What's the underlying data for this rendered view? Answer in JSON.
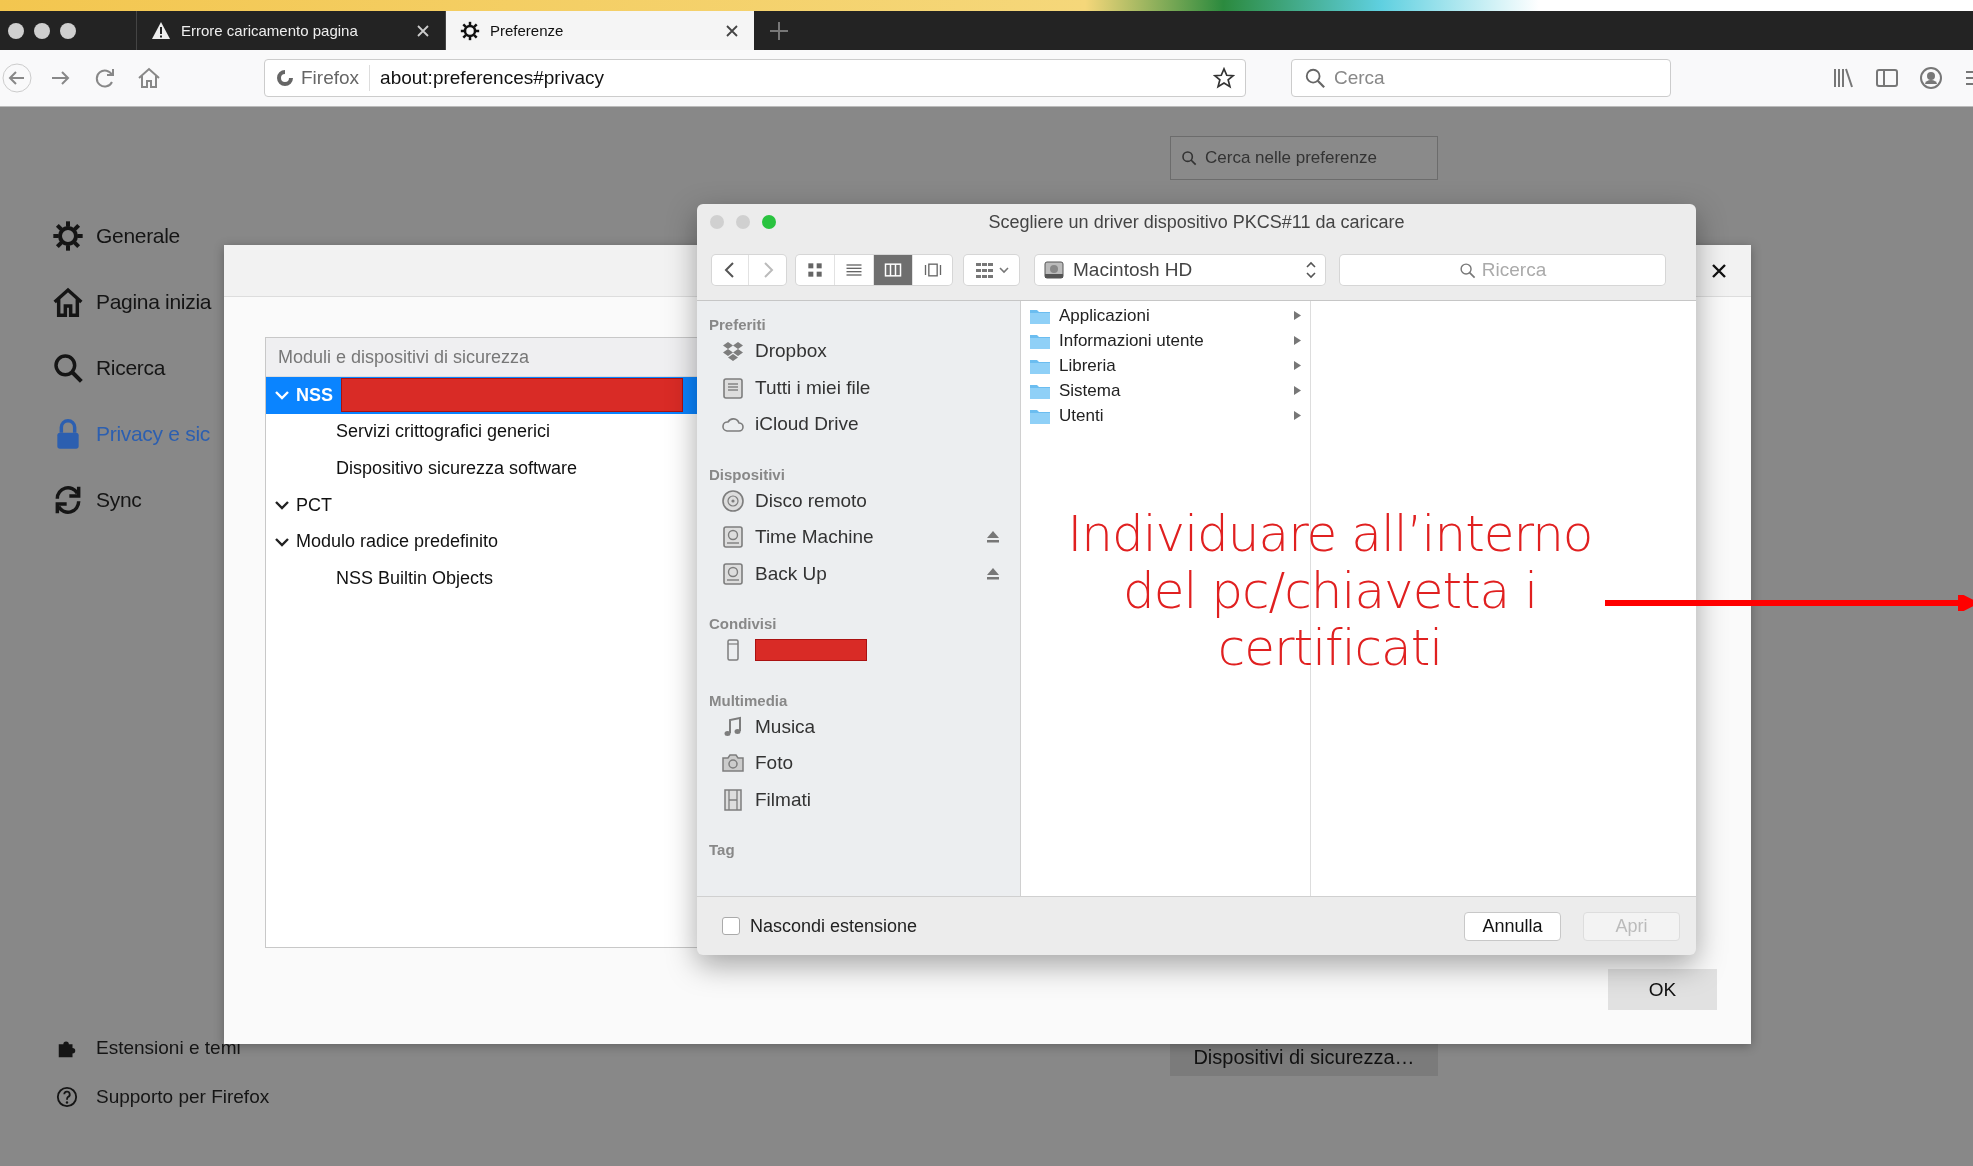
{
  "browser": {
    "tabs": [
      {
        "title": "Errore caricamento pagina",
        "kind": "warning",
        "selected": false
      },
      {
        "title": "Preferenze",
        "kind": "settings",
        "selected": true
      }
    ],
    "url_bar": {
      "identity": "Firefox",
      "value": "about:preferences#privacy"
    },
    "search": {
      "placeholder": "Cerca"
    }
  },
  "preferences": {
    "search": {
      "placeholder": "Cerca nelle preferenze"
    },
    "sidebar": {
      "items": [
        {
          "label": "Generale",
          "kind": "gear",
          "selected": false
        },
        {
          "label": "Pagina inizia",
          "kind": "home",
          "selected": false
        },
        {
          "label": "Ricerca",
          "kind": "search",
          "selected": false
        },
        {
          "label": "Privacy e sic",
          "kind": "lock",
          "selected": true
        },
        {
          "label": "Sync",
          "kind": "sync",
          "selected": false
        }
      ],
      "footer": [
        {
          "label": "Estensioni e temi",
          "kind": "puzzle"
        },
        {
          "label": "Supporto per Firefox",
          "kind": "help"
        }
      ]
    },
    "security_devices_button": "Dispositivi di sicurezza…"
  },
  "device_manager": {
    "tree": {
      "header": "Moduli e dispositivi di sicurezza",
      "items": [
        {
          "label": "NSS",
          "selected": true,
          "expanded": true,
          "children": [
            {
              "label": "Servizi crittografici generici",
              "selected": false
            },
            {
              "label": "Dispositivo sicurezza software",
              "selected": false
            }
          ]
        },
        {
          "label": "PCT",
          "selected": false,
          "expanded": true
        },
        {
          "label": "Modulo radice predefinito",
          "selected": false,
          "expanded": true,
          "children": [
            {
              "label": "NSS Builtin Objects",
              "selected": false
            }
          ]
        }
      ]
    },
    "ok_button": "OK"
  },
  "file_dialog": {
    "title": "Scegliere un driver dispositivo PKCS#11 da caricare",
    "view_modes": [
      {
        "kind": "icons",
        "selected": false
      },
      {
        "kind": "list",
        "selected": false
      },
      {
        "kind": "columns",
        "selected": true
      },
      {
        "kind": "coverflow",
        "selected": false
      }
    ],
    "location": "Macintosh HD",
    "search": {
      "placeholder": "Ricerca"
    },
    "sidebar": {
      "sections": [
        {
          "title": "Preferiti",
          "items": [
            {
              "label": "Dropbox",
              "kind": "dropbox",
              "ejectable": false
            },
            {
              "label": "Tutti i miei file",
              "kind": "files",
              "ejectable": false
            },
            {
              "label": "iCloud Drive",
              "kind": "cloud",
              "ejectable": false
            }
          ]
        },
        {
          "title": "Dispositivi",
          "items": [
            {
              "label": "Disco remoto",
              "kind": "disc",
              "ejectable": false
            },
            {
              "label": "Time Machine",
              "kind": "drive",
              "ejectable": true
            },
            {
              "label": "Back Up",
              "kind": "drive",
              "ejectable": true
            }
          ]
        },
        {
          "title": "Condivisi",
          "items": [
            {
              "kind": "redacted",
              "ejectable": false
            }
          ]
        },
        {
          "title": "Multimedia",
          "items": [
            {
              "label": "Musica",
              "kind": "music",
              "ejectable": false
            },
            {
              "label": "Foto",
              "kind": "camera",
              "ejectable": false
            },
            {
              "label": "Filmati",
              "kind": "film",
              "ejectable": false
            }
          ]
        },
        {
          "title": "Tag"
        }
      ]
    },
    "folders": [
      {
        "label": "Applicazioni"
      },
      {
        "label": "Informazioni utente"
      },
      {
        "label": "Libreria"
      },
      {
        "label": "Sistema"
      },
      {
        "label": "Utenti"
      }
    ],
    "hide_extension": {
      "label": "Nascondi estensione",
      "checked": false
    },
    "buttons": [
      {
        "label": "Annulla",
        "disabled": false
      },
      {
        "label": "Apri",
        "disabled": true
      }
    ]
  },
  "annotation": {
    "lines": [
      "Individuare all’interno",
      "del pc/chiavetta i",
      "certificati"
    ]
  }
}
